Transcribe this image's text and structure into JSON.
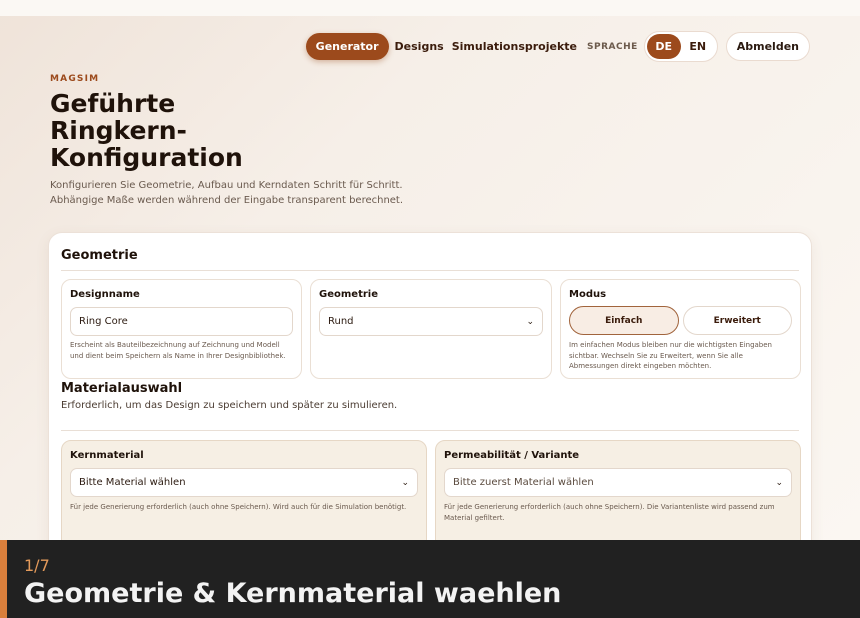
{
  "nav": {
    "generator": "Generator",
    "designs": "Designs",
    "projects": "Simulationsprojekte",
    "language_label": "SPRACHE",
    "lang_de": "DE",
    "lang_en": "EN",
    "logout": "Abmelden"
  },
  "hero": {
    "brand": "MAGSIM",
    "title": "Geführte Ringkern-Konfiguration",
    "subtitle": "Konfigurieren Sie Geometrie, Aufbau und Kerndaten Schritt für Schritt. Abhängige Maße werden während der Eingabe transparent berechnet."
  },
  "geometry": {
    "title": "Geometrie",
    "designname": {
      "label": "Designname",
      "value": "Ring Core",
      "help": "Erscheint als Bauteilbezeichnung auf Zeichnung und Modell und dient beim Speichern als Name in Ihrer Designbibliothek."
    },
    "shape": {
      "label": "Geometrie",
      "value": "Rund"
    },
    "mode": {
      "label": "Modus",
      "simple": "Einfach",
      "advanced": "Erweitert",
      "help": "Im einfachen Modus bleiben nur die wichtigsten Eingaben sichtbar. Wechseln Sie zu Erweitert, wenn Sie alle Abmessungen direkt eingeben möchten."
    }
  },
  "material": {
    "title": "Materialauswahl",
    "subtitle": "Erforderlich, um das Design zu speichern und später zu simulieren.",
    "core": {
      "label": "Kernmaterial",
      "value": "Bitte Material wählen",
      "help": "Für jede Generierung erforderlich (auch ohne Speichern). Wird auch für die Simulation benötigt."
    },
    "permeability": {
      "label": "Permeabilität / Variante",
      "value": "Bitte zuerst Material wählen",
      "help": "Für jede Generierung erforderlich (auch ohne Speichern). Die Variantenliste wird passend zum Material gefiltert."
    }
  },
  "caption": {
    "step": "1/7",
    "title": "Geometrie & Kernmaterial waehlen"
  },
  "colors": {
    "accent": "#9c4a1c",
    "caption_accent": "#d97f3c"
  }
}
